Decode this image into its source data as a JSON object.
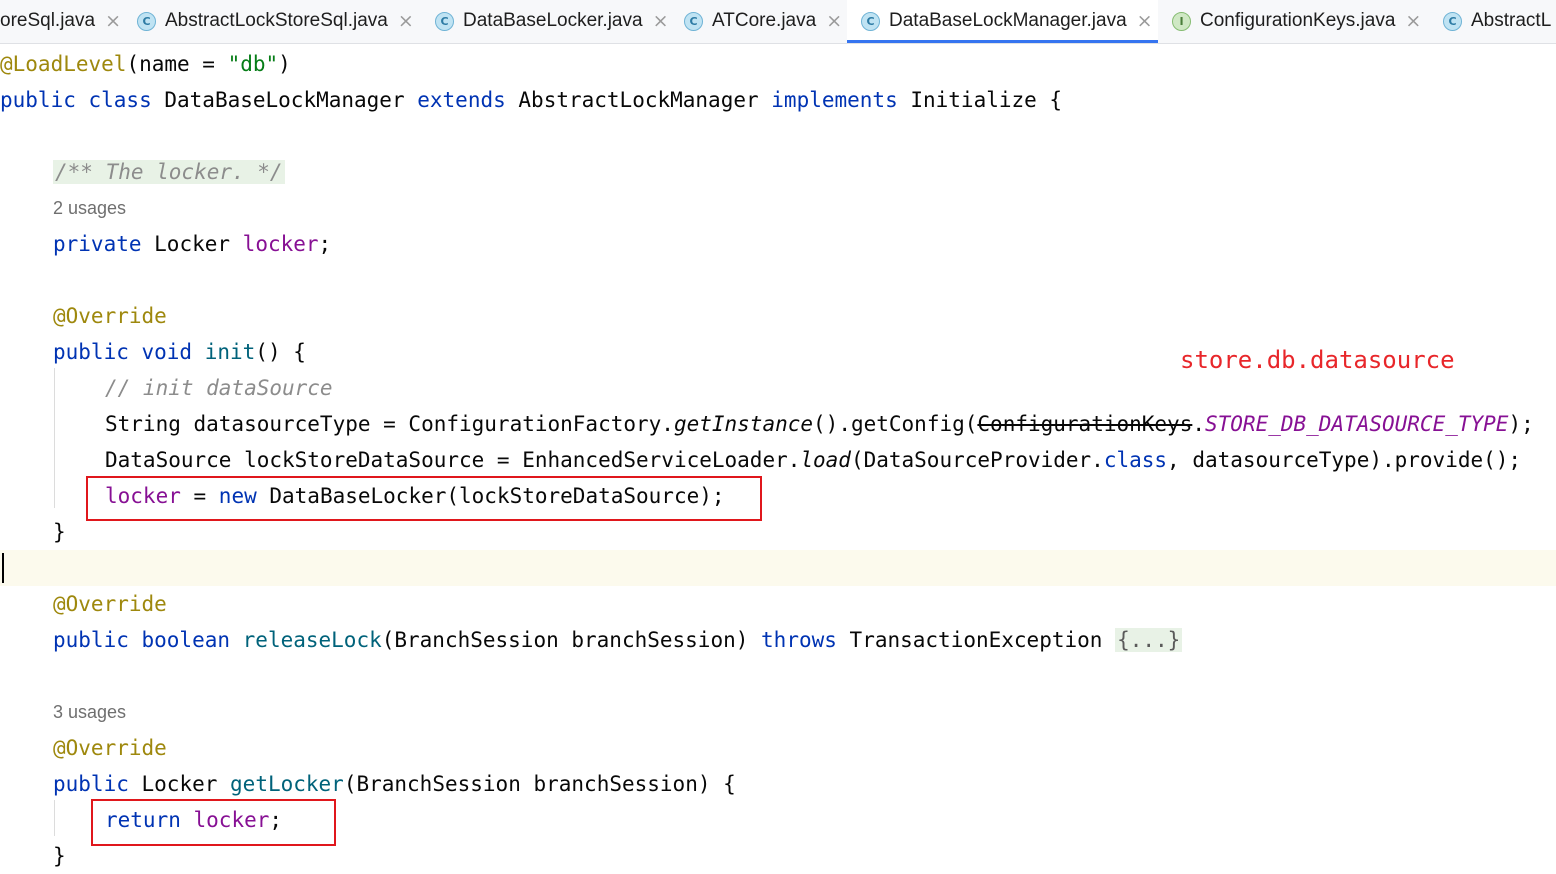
{
  "tabs": [
    {
      "label": "oreSql.java",
      "icon": "none",
      "active": false
    },
    {
      "label": "AbstractLockStoreSql.java",
      "icon": "class-icon",
      "active": false
    },
    {
      "label": "DataBaseLocker.java",
      "icon": "class-icon",
      "active": false
    },
    {
      "label": "ATCore.java",
      "icon": "class-icon",
      "active": false
    },
    {
      "label": "DataBaseLockManager.java",
      "icon": "class-icon",
      "active": true
    },
    {
      "label": "ConfigurationKeys.java",
      "icon": "interface-icon",
      "active": false
    },
    {
      "label": "AbstractL",
      "icon": "class-icon",
      "active": false
    }
  ],
  "icons": {
    "class_letter": "C",
    "interface_letter": "I",
    "close_glyph": "×"
  },
  "code": {
    "l1": {
      "ann": "@LoadLevel",
      "a": "(name = ",
      "str": "\"db\"",
      "b": ")"
    },
    "l2": {
      "kw1": "public class ",
      "cls": "DataBaseLockManager ",
      "kw2": "extends ",
      "sup": "AbstractLockManager ",
      "kw3": "implements ",
      "iface": "Initialize {"
    },
    "l3": {
      "doc": "/** The locker. */"
    },
    "hint1": "2 usages",
    "l4": {
      "kw": "private ",
      "type": "Locker ",
      "fld": "locker",
      "end": ";"
    },
    "l5": {
      "ann": "@Override"
    },
    "l6": {
      "kw": "public void ",
      "mth": "init",
      "end": "() {"
    },
    "l7": {
      "cmt": "// init dataSource"
    },
    "l8": {
      "a": "String datasourceType = ConfigurationFactory.",
      "m1": "getInstance",
      "b": "().getConfig(",
      "dep": "ConfigurationKeys",
      "dot": ".",
      "stat": "STORE_DB_DATASOURCE_TYPE",
      "end": ");"
    },
    "l9": {
      "a": "DataSource lockStoreDataSource = EnhancedServiceLoader.",
      "m1": "load",
      "b": "(DataSourceProvider.",
      "kw": "class",
      "end": ", datasourceType).provide();"
    },
    "l10": {
      "fld": "locker",
      "a": " = ",
      "kw": "new ",
      "end": "DataBaseLocker(lockStoreDataSource);"
    },
    "l11": {
      "text": "}"
    },
    "l12": {
      "ann": "@Override"
    },
    "l13": {
      "kw": "public boolean ",
      "mth": "releaseLock",
      "a": "(BranchSession branchSession) ",
      "kw2": "throws ",
      "b": "TransactionException ",
      "fold": "{...}"
    },
    "hint2": "3 usages",
    "l14": {
      "ann": "@Override"
    },
    "l15": {
      "kw": "public ",
      "type": "Locker ",
      "mth": "getLocker",
      "end": "(BranchSession branchSession) {"
    },
    "l16": {
      "kw": "return ",
      "fld": "locker",
      "end": ";"
    },
    "l17": {
      "text": "}"
    }
  },
  "annotation_note": "store.db.datasource",
  "colors": {
    "keyword": "#0033b3",
    "annotation": "#9e880d",
    "string": "#067d17",
    "field": "#871094",
    "method": "#00627a",
    "comment": "#8c8c8c",
    "highlight_box": "#e0171c"
  }
}
